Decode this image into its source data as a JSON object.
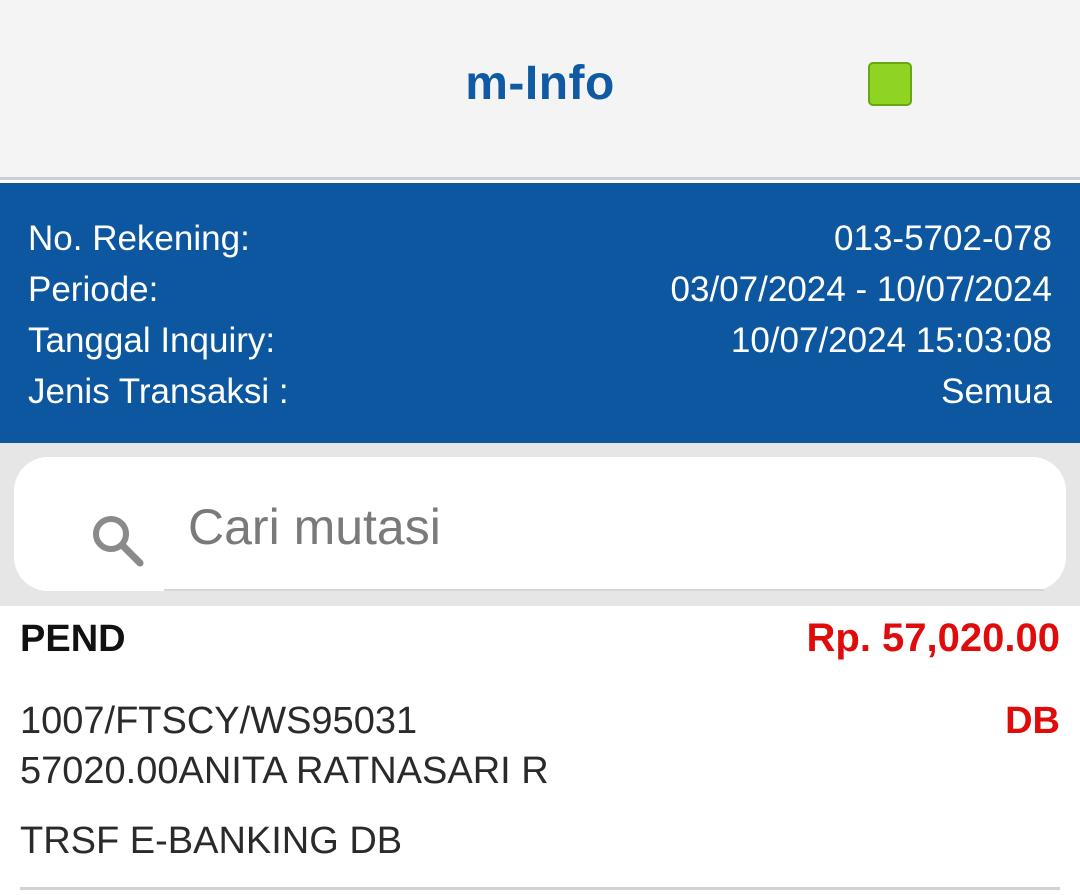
{
  "header": {
    "title": "m-Info",
    "status_color": "#8fd422"
  },
  "account_info": {
    "rows": [
      {
        "label": "No. Rekening:",
        "value": "013-5702-078"
      },
      {
        "label": "Periode:",
        "value": "03/07/2024 - 10/07/2024"
      },
      {
        "label": "Tanggal Inquiry:",
        "value": "10/07/2024 15:03:08"
      },
      {
        "label": "Jenis Transaksi :",
        "value": "Semua"
      }
    ]
  },
  "search": {
    "placeholder": "Cari mutasi",
    "value": "",
    "icon": "search-icon"
  },
  "transactions": [
    {
      "status": "PEND",
      "amount": "Rp. 57,020.00",
      "description_line1": "1007/FTSCY/WS95031",
      "description_line2": "57020.00ANITA RATNASARI R",
      "type": "DB",
      "category": "TRSF E-BANKING DB"
    }
  ],
  "colors": {
    "brand_blue": "#0d56a0",
    "debit_red": "#e00c0c"
  }
}
